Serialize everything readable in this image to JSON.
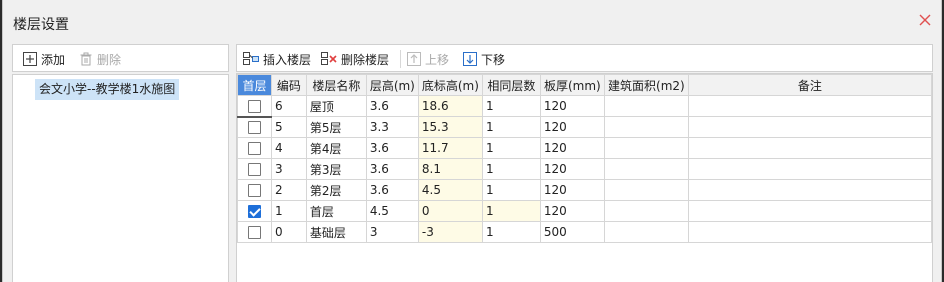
{
  "dialog": {
    "title": "楼层设置"
  },
  "left_toolbar": {
    "add_label": "添加",
    "delete_label": "删除"
  },
  "tree": {
    "items": [
      "会文小学--教学楼1水施图"
    ]
  },
  "right_toolbar": {
    "insert_label": "插入楼层",
    "delete_label": "删除楼层",
    "up_label": "上移",
    "down_label": "下移"
  },
  "table": {
    "headers": [
      "首层",
      "编码",
      "楼层名称",
      "层高(m)",
      "底标高(m)",
      "相同层数",
      "板厚(mm)",
      "建筑面积(m2)",
      "备注"
    ],
    "rows": [
      {
        "checked": false,
        "code": "6",
        "name": "屋顶",
        "height": "3.6",
        "base_elev": "18.6",
        "same_count": "1",
        "slab": "120",
        "area": "",
        "note": ""
      },
      {
        "checked": false,
        "code": "5",
        "name": "第5层",
        "height": "3.3",
        "base_elev": "15.3",
        "same_count": "1",
        "slab": "120",
        "area": "",
        "note": ""
      },
      {
        "checked": false,
        "code": "4",
        "name": "第4层",
        "height": "3.6",
        "base_elev": "11.7",
        "same_count": "1",
        "slab": "120",
        "area": "",
        "note": ""
      },
      {
        "checked": false,
        "code": "3",
        "name": "第3层",
        "height": "3.6",
        "base_elev": "8.1",
        "same_count": "1",
        "slab": "120",
        "area": "",
        "note": ""
      },
      {
        "checked": false,
        "code": "2",
        "name": "第2层",
        "height": "3.6",
        "base_elev": "4.5",
        "same_count": "1",
        "slab": "120",
        "area": "",
        "note": ""
      },
      {
        "checked": true,
        "code": "1",
        "name": "首层",
        "height": "4.5",
        "base_elev": "0",
        "same_count": "1",
        "slab": "120",
        "area": "",
        "note": ""
      },
      {
        "checked": false,
        "code": "0",
        "name": "基础层",
        "height": "3",
        "base_elev": "-3",
        "same_count": "1",
        "slab": "500",
        "area": "",
        "note": ""
      }
    ]
  },
  "colors": {
    "header_active": "#4a89dc",
    "selection": "#cde3f7",
    "readonly_cell": "#fefbe6",
    "close_icon": "#e05050"
  }
}
